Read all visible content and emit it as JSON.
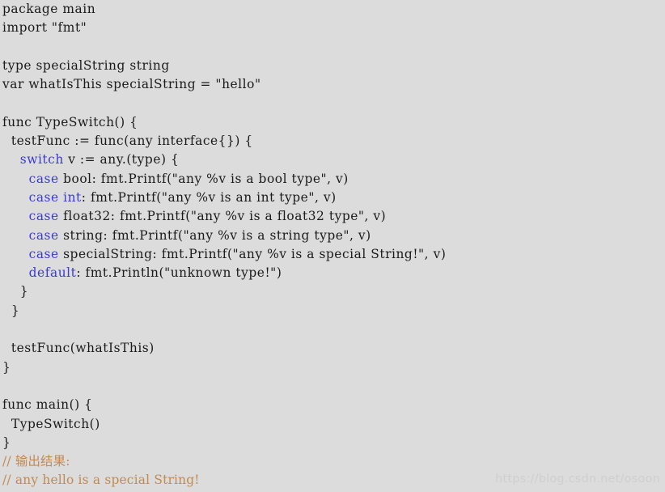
{
  "editor": {
    "language": "go",
    "background_color": "#dcdcdc",
    "text_color": "#1a1a1a",
    "keyword_color": "#3b3bd0",
    "comment_color": "#c08a55",
    "lines": [
      {
        "id": 1,
        "text": "package main",
        "segments": [
          {
            "t": "package main",
            "c": "plain"
          }
        ]
      },
      {
        "id": 2,
        "text": "import \"fmt\"",
        "segments": [
          {
            "t": "import \"fmt\"",
            "c": "plain"
          }
        ]
      },
      {
        "id": 3,
        "text": "",
        "segments": []
      },
      {
        "id": 4,
        "text": "type specialString string",
        "segments": [
          {
            "t": "type specialString string",
            "c": "plain"
          }
        ]
      },
      {
        "id": 5,
        "text": "var whatIsThis specialString = \"hello\"",
        "segments": [
          {
            "t": "var whatIsThis specialString = \"hello\"",
            "c": "plain"
          }
        ]
      },
      {
        "id": 6,
        "text": "",
        "segments": []
      },
      {
        "id": 7,
        "text": "func TypeSwitch() {",
        "segments": [
          {
            "t": "func TypeSwitch() {",
            "c": "plain"
          }
        ]
      },
      {
        "id": 8,
        "text": "  testFunc := func(any interface{}) {",
        "segments": [
          {
            "t": "  testFunc := func(any interface{}) {",
            "c": "plain"
          }
        ]
      },
      {
        "id": 9,
        "text": "    switch v := any.(type) {",
        "segments": [
          {
            "t": "    ",
            "c": "plain"
          },
          {
            "t": "switch",
            "c": "kw"
          },
          {
            "t": " v := any.(type) {",
            "c": "plain"
          }
        ]
      },
      {
        "id": 10,
        "text": "      case bool: fmt.Printf(\"any %v is a bool type\", v)",
        "segments": [
          {
            "t": "      ",
            "c": "plain"
          },
          {
            "t": "case",
            "c": "kw"
          },
          {
            "t": " bool: fmt.Printf(\"any %v is a bool type\", v)",
            "c": "plain"
          }
        ]
      },
      {
        "id": 11,
        "text": "      case int: fmt.Printf(\"any %v is an int type\", v)",
        "segments": [
          {
            "t": "      ",
            "c": "plain"
          },
          {
            "t": "case",
            "c": "kw"
          },
          {
            "t": " ",
            "c": "plain"
          },
          {
            "t": "int",
            "c": "kw"
          },
          {
            "t": ": fmt.Printf(\"any %v is an int type\", v)",
            "c": "plain"
          }
        ]
      },
      {
        "id": 12,
        "text": "      case float32: fmt.Printf(\"any %v is a float32 type\", v)",
        "segments": [
          {
            "t": "      ",
            "c": "plain"
          },
          {
            "t": "case",
            "c": "kw"
          },
          {
            "t": " float32: fmt.Printf(\"any %v is a float32 type\", v)",
            "c": "plain"
          }
        ]
      },
      {
        "id": 13,
        "text": "      case string: fmt.Printf(\"any %v is a string type\", v)",
        "segments": [
          {
            "t": "      ",
            "c": "plain"
          },
          {
            "t": "case",
            "c": "kw"
          },
          {
            "t": " string: fmt.Printf(\"any %v is a string type\", v)",
            "c": "plain"
          }
        ]
      },
      {
        "id": 14,
        "text": "      case specialString: fmt.Printf(\"any %v is a special String!\", v)",
        "segments": [
          {
            "t": "      ",
            "c": "plain"
          },
          {
            "t": "case",
            "c": "kw"
          },
          {
            "t": " specialString: fmt.Printf(\"any %v is a special String!\", v)",
            "c": "plain"
          }
        ]
      },
      {
        "id": 15,
        "text": "      default: fmt.Println(\"unknown type!\")",
        "segments": [
          {
            "t": "      ",
            "c": "plain"
          },
          {
            "t": "default",
            "c": "kw"
          },
          {
            "t": ": fmt.Println(\"unknown type!\")",
            "c": "plain"
          }
        ]
      },
      {
        "id": 16,
        "text": "    }",
        "segments": [
          {
            "t": "    }",
            "c": "plain"
          }
        ]
      },
      {
        "id": 17,
        "text": "  }",
        "segments": [
          {
            "t": "  }",
            "c": "plain"
          }
        ]
      },
      {
        "id": 18,
        "text": "",
        "segments": []
      },
      {
        "id": 19,
        "text": "  testFunc(whatIsThis)",
        "segments": [
          {
            "t": "  testFunc(whatIsThis)",
            "c": "plain"
          }
        ]
      },
      {
        "id": 20,
        "text": "}",
        "segments": [
          {
            "t": "}",
            "c": "plain"
          }
        ]
      },
      {
        "id": 21,
        "text": "",
        "segments": []
      },
      {
        "id": 22,
        "text": "func main() {",
        "segments": [
          {
            "t": "func main() {",
            "c": "plain"
          }
        ]
      },
      {
        "id": 23,
        "text": "  TypeSwitch()",
        "segments": [
          {
            "t": "  TypeSwitch()",
            "c": "plain"
          }
        ]
      },
      {
        "id": 24,
        "text": "}",
        "segments": [
          {
            "t": "}",
            "c": "plain"
          }
        ]
      },
      {
        "id": 25,
        "text": "// 输出结果:",
        "segments": [
          {
            "t": "// 输出结果:",
            "c": "comment"
          }
        ]
      },
      {
        "id": 26,
        "text": "// any hello is a special String!",
        "segments": [
          {
            "t": "// any hello is a special String!",
            "c": "comment"
          }
        ]
      }
    ]
  },
  "watermark": {
    "text": "https://blog.csdn.net/osoon",
    "color": "#cfcfcf"
  }
}
